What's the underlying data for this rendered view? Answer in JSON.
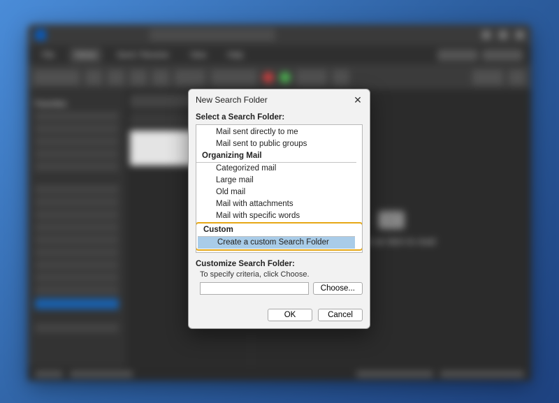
{
  "menubar": {
    "items": [
      "File",
      "Home",
      "Send / Receive",
      "View",
      "Help"
    ],
    "active": 1
  },
  "reading_pane_hint": "Select an item to read",
  "dialog": {
    "title": "New Search Folder",
    "select_label": "Select a Search Folder:",
    "groups": [
      {
        "name": "",
        "items": [
          "Mail sent directly to me",
          "Mail sent to public groups"
        ]
      },
      {
        "name": "Organizing Mail",
        "items": [
          "Categorized mail",
          "Large mail",
          "Old mail",
          "Mail with attachments",
          "Mail with specific words"
        ]
      },
      {
        "name": "Custom",
        "items": [
          "Create a custom Search Folder"
        ]
      }
    ],
    "selected_item": "Create a custom Search Folder",
    "customize_label": "Customize Search Folder:",
    "hint_text": "To specify criteria, click Choose.",
    "choose_btn": "Choose...",
    "ok_btn": "OK",
    "cancel_btn": "Cancel"
  }
}
